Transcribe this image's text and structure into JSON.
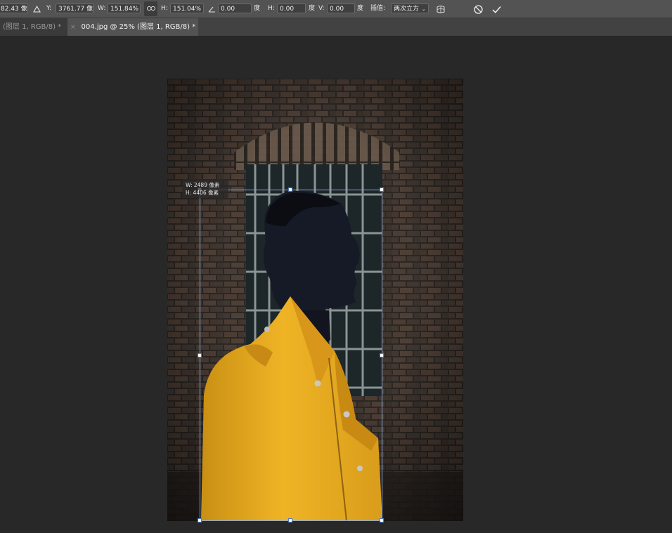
{
  "optbar": {
    "x_value": "82.43 像",
    "ref_icon": "triangle-icon",
    "y_label": "Y:",
    "y_value": "3761.77 像素",
    "w_label": "W:",
    "w_value": "151.84%",
    "link_icon": "chain-link-icon",
    "h_label": "H:",
    "h_value": "151.04%",
    "angle_value": "0.00",
    "angle_unit": "度",
    "skew_h_label": "H:",
    "skew_h_value": "0.00",
    "skew_h_unit": "度",
    "skew_v_label": "V:",
    "skew_v_value": "0.00",
    "skew_v_unit": "度",
    "interp_label": "插值:",
    "interp_value": "两次立方",
    "warp_icon": "warp-icon",
    "cancel_icon": "cancel-icon",
    "commit_icon": "checkmark-icon"
  },
  "tabs": [
    {
      "label": "(图层 1, RGB/8) *"
    },
    {
      "label": "004.jpg @ 25% (图层 1, RGB/8) *"
    }
  ],
  "transform_info": {
    "w": "W: 2489 像素",
    "h": "H: 4406 像素"
  },
  "colors": {
    "jacket": "#e9a91e",
    "wall": "#4a3a30",
    "handle_border": "#4a7bd0"
  }
}
